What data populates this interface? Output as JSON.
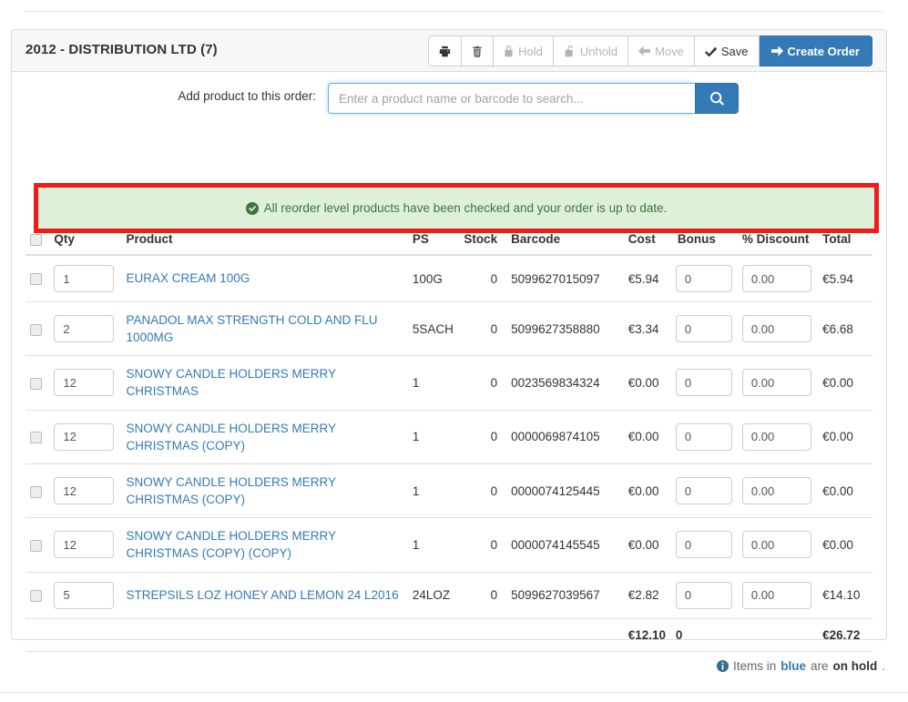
{
  "header": {
    "title": "2012 - DISTRIBUTION LTD (7)"
  },
  "toolbar": {
    "print_icon": "printer-icon",
    "delete_icon": "trash-icon",
    "hold_label": "Hold",
    "unhold_label": "Unhold",
    "move_label": "Move",
    "save_label": "Save",
    "create_order_label": "Create Order",
    "primary_color": "#337ab7"
  },
  "search": {
    "label": "Add product to this order:",
    "placeholder": "Enter a product name or barcode to search...",
    "value": "",
    "button_icon": "search-icon"
  },
  "alert": {
    "icon": "check-circle-icon",
    "message": "All reorder level products have been checked and your order is up to date.",
    "text_color": "#3c763d",
    "background_color": "#dff0d8",
    "annotation_color": "#ef1b1b"
  },
  "table": {
    "columns": [
      "",
      "Qty",
      "Product",
      "PS",
      "Stock",
      "Barcode",
      "Cost",
      "Bonus",
      "% Discount",
      "Total"
    ],
    "rows": [
      {
        "qty": "1",
        "product": "EURAX CREAM 100G",
        "ps": "100G",
        "stock": "0",
        "barcode": "5099627015097",
        "cost": "€5.94",
        "bonus": "0",
        "discount": "0.00",
        "total": "€5.94"
      },
      {
        "qty": "2",
        "product": "PANADOL MAX STRENGTH COLD AND FLU 1000MG",
        "ps": "5SACH",
        "stock": "0",
        "barcode": "5099627358880",
        "cost": "€3.34",
        "bonus": "0",
        "discount": "0.00",
        "total": "€6.68"
      },
      {
        "qty": "12",
        "product": "SNOWY CANDLE HOLDERS MERRY CHRISTMAS",
        "ps": "1",
        "stock": "0",
        "barcode": "0023569834324",
        "cost": "€0.00",
        "bonus": "0",
        "discount": "0.00",
        "total": "€0.00"
      },
      {
        "qty": "12",
        "product": "SNOWY CANDLE HOLDERS MERRY CHRISTMAS (COPY)",
        "ps": "1",
        "stock": "0",
        "barcode": "0000069874105",
        "cost": "€0.00",
        "bonus": "0",
        "discount": "0.00",
        "total": "€0.00"
      },
      {
        "qty": "12",
        "product": "SNOWY CANDLE HOLDERS MERRY CHRISTMAS (COPY)",
        "ps": "1",
        "stock": "0",
        "barcode": "0000074125445",
        "cost": "€0.00",
        "bonus": "0",
        "discount": "0.00",
        "total": "€0.00"
      },
      {
        "qty": "12",
        "product": "SNOWY CANDLE HOLDERS MERRY CHRISTMAS (COPY) (COPY)",
        "ps": "1",
        "stock": "0",
        "barcode": "0000074145545",
        "cost": "€0.00",
        "bonus": "0",
        "discount": "0.00",
        "total": "€0.00"
      },
      {
        "qty": "5",
        "product": "STREPSILS LOZ HONEY AND LEMON 24 L2016",
        "ps": "24LOZ",
        "stock": "0",
        "barcode": "5099627039567",
        "cost": "€2.82",
        "bonus": "0",
        "discount": "0.00",
        "total": "€14.10"
      }
    ],
    "totals": {
      "cost": "€12.10",
      "bonus": "0",
      "total": "€26.72"
    }
  },
  "footer": {
    "icon": "info-circle-icon",
    "prefix": "Items in ",
    "blue_word": "blue",
    "middle": " are ",
    "bold_word": "on hold",
    "suffix": "."
  }
}
